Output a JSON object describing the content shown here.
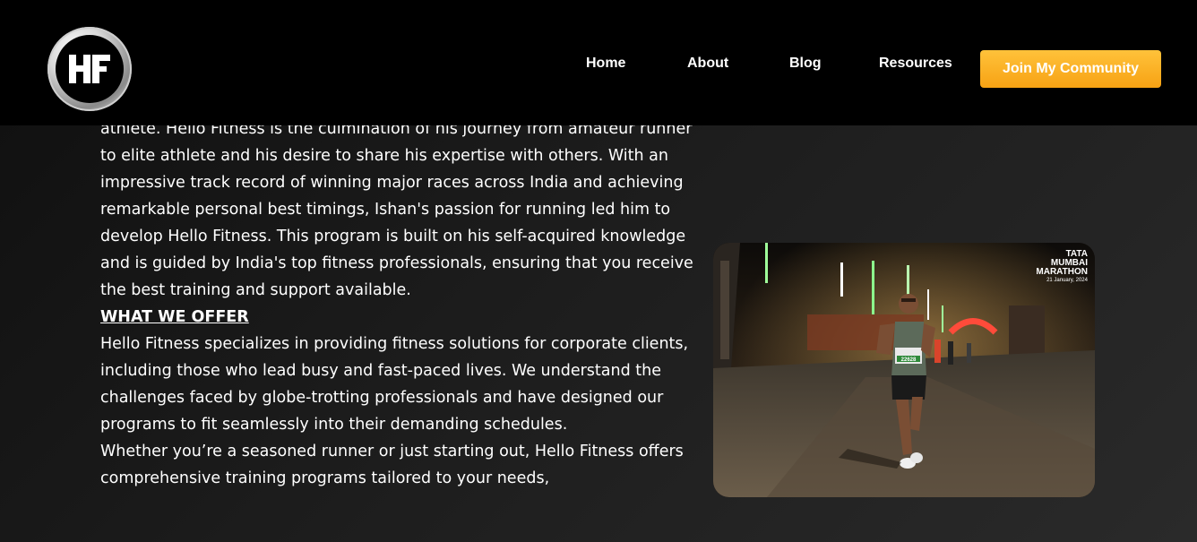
{
  "header": {
    "nav": [
      "Home",
      "About",
      "Blog",
      "Resources"
    ],
    "cta_label": "Join My Community"
  },
  "content": {
    "para1": "athlete. Hello Fitness is the culmination of his journey from amateur runner to elite athlete and his desire to share his expertise with others. With an impressive track record of winning major races across India and achieving remarkable personal best timings, Ishan's passion for running led him to develop Hello Fitness. This program is built on his self-acquired knowledge and is guided by India's top fitness professionals, ensuring that you receive the best training and support available.",
    "heading": "WHAT WE OFFER",
    "para2": "Hello Fitness specializes in providing fitness solutions for corporate clients, including those who lead busy and fast-paced lives. We understand the challenges faced by globe-trotting professionals and have designed our programs to fit seamlessly into their demanding schedules.",
    "para3": "Whether you’re a seasoned runner or just starting out, Hello Fitness offers comprehensive training programs tailored to your needs,"
  },
  "photo": {
    "badge_line1": "TATA",
    "badge_line2": "MUMBAI MARATHON",
    "badge_line3": "21 January, 2024",
    "bib_number": "22628"
  },
  "colors": {
    "cta_gradient_top": "#ffc23a",
    "cta_gradient_bottom": "#f7a214",
    "header_bg": "#000000",
    "text": "#ffffff"
  },
  "icons": {
    "logo": "hf-logo-icon"
  }
}
